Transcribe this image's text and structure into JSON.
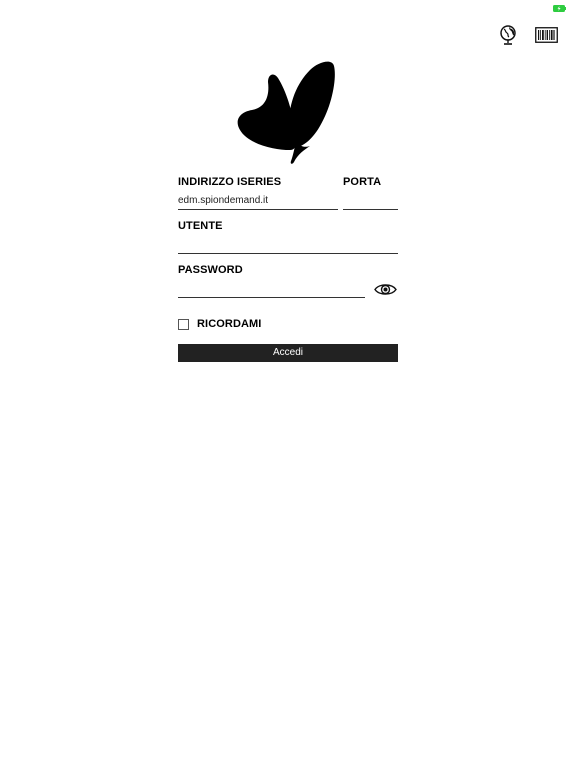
{
  "status_bar": {
    "battery_icon": "battery-charging-icon",
    "battery_color": "#2ecc40"
  },
  "toolbar": {
    "globe_icon": "globe-icon",
    "barcode_icon": "barcode-scanner-icon"
  },
  "logo": {
    "icon": "butterfly-logo"
  },
  "form": {
    "server": {
      "label": "INDIRIZZO ISERIES",
      "value": "edm.spiondemand.it"
    },
    "port": {
      "label": "PORTA",
      "value": ""
    },
    "user": {
      "label": "UTENTE",
      "value": ""
    },
    "password": {
      "label": "PASSWORD",
      "value": "",
      "toggle_icon": "eye-icon"
    },
    "remember": {
      "label": "RICORDAMI",
      "checked": false
    },
    "submit_label": "Accedi"
  },
  "colors": {
    "button_bg": "#222222",
    "button_text": "#ffffff",
    "underline": "#333333"
  }
}
